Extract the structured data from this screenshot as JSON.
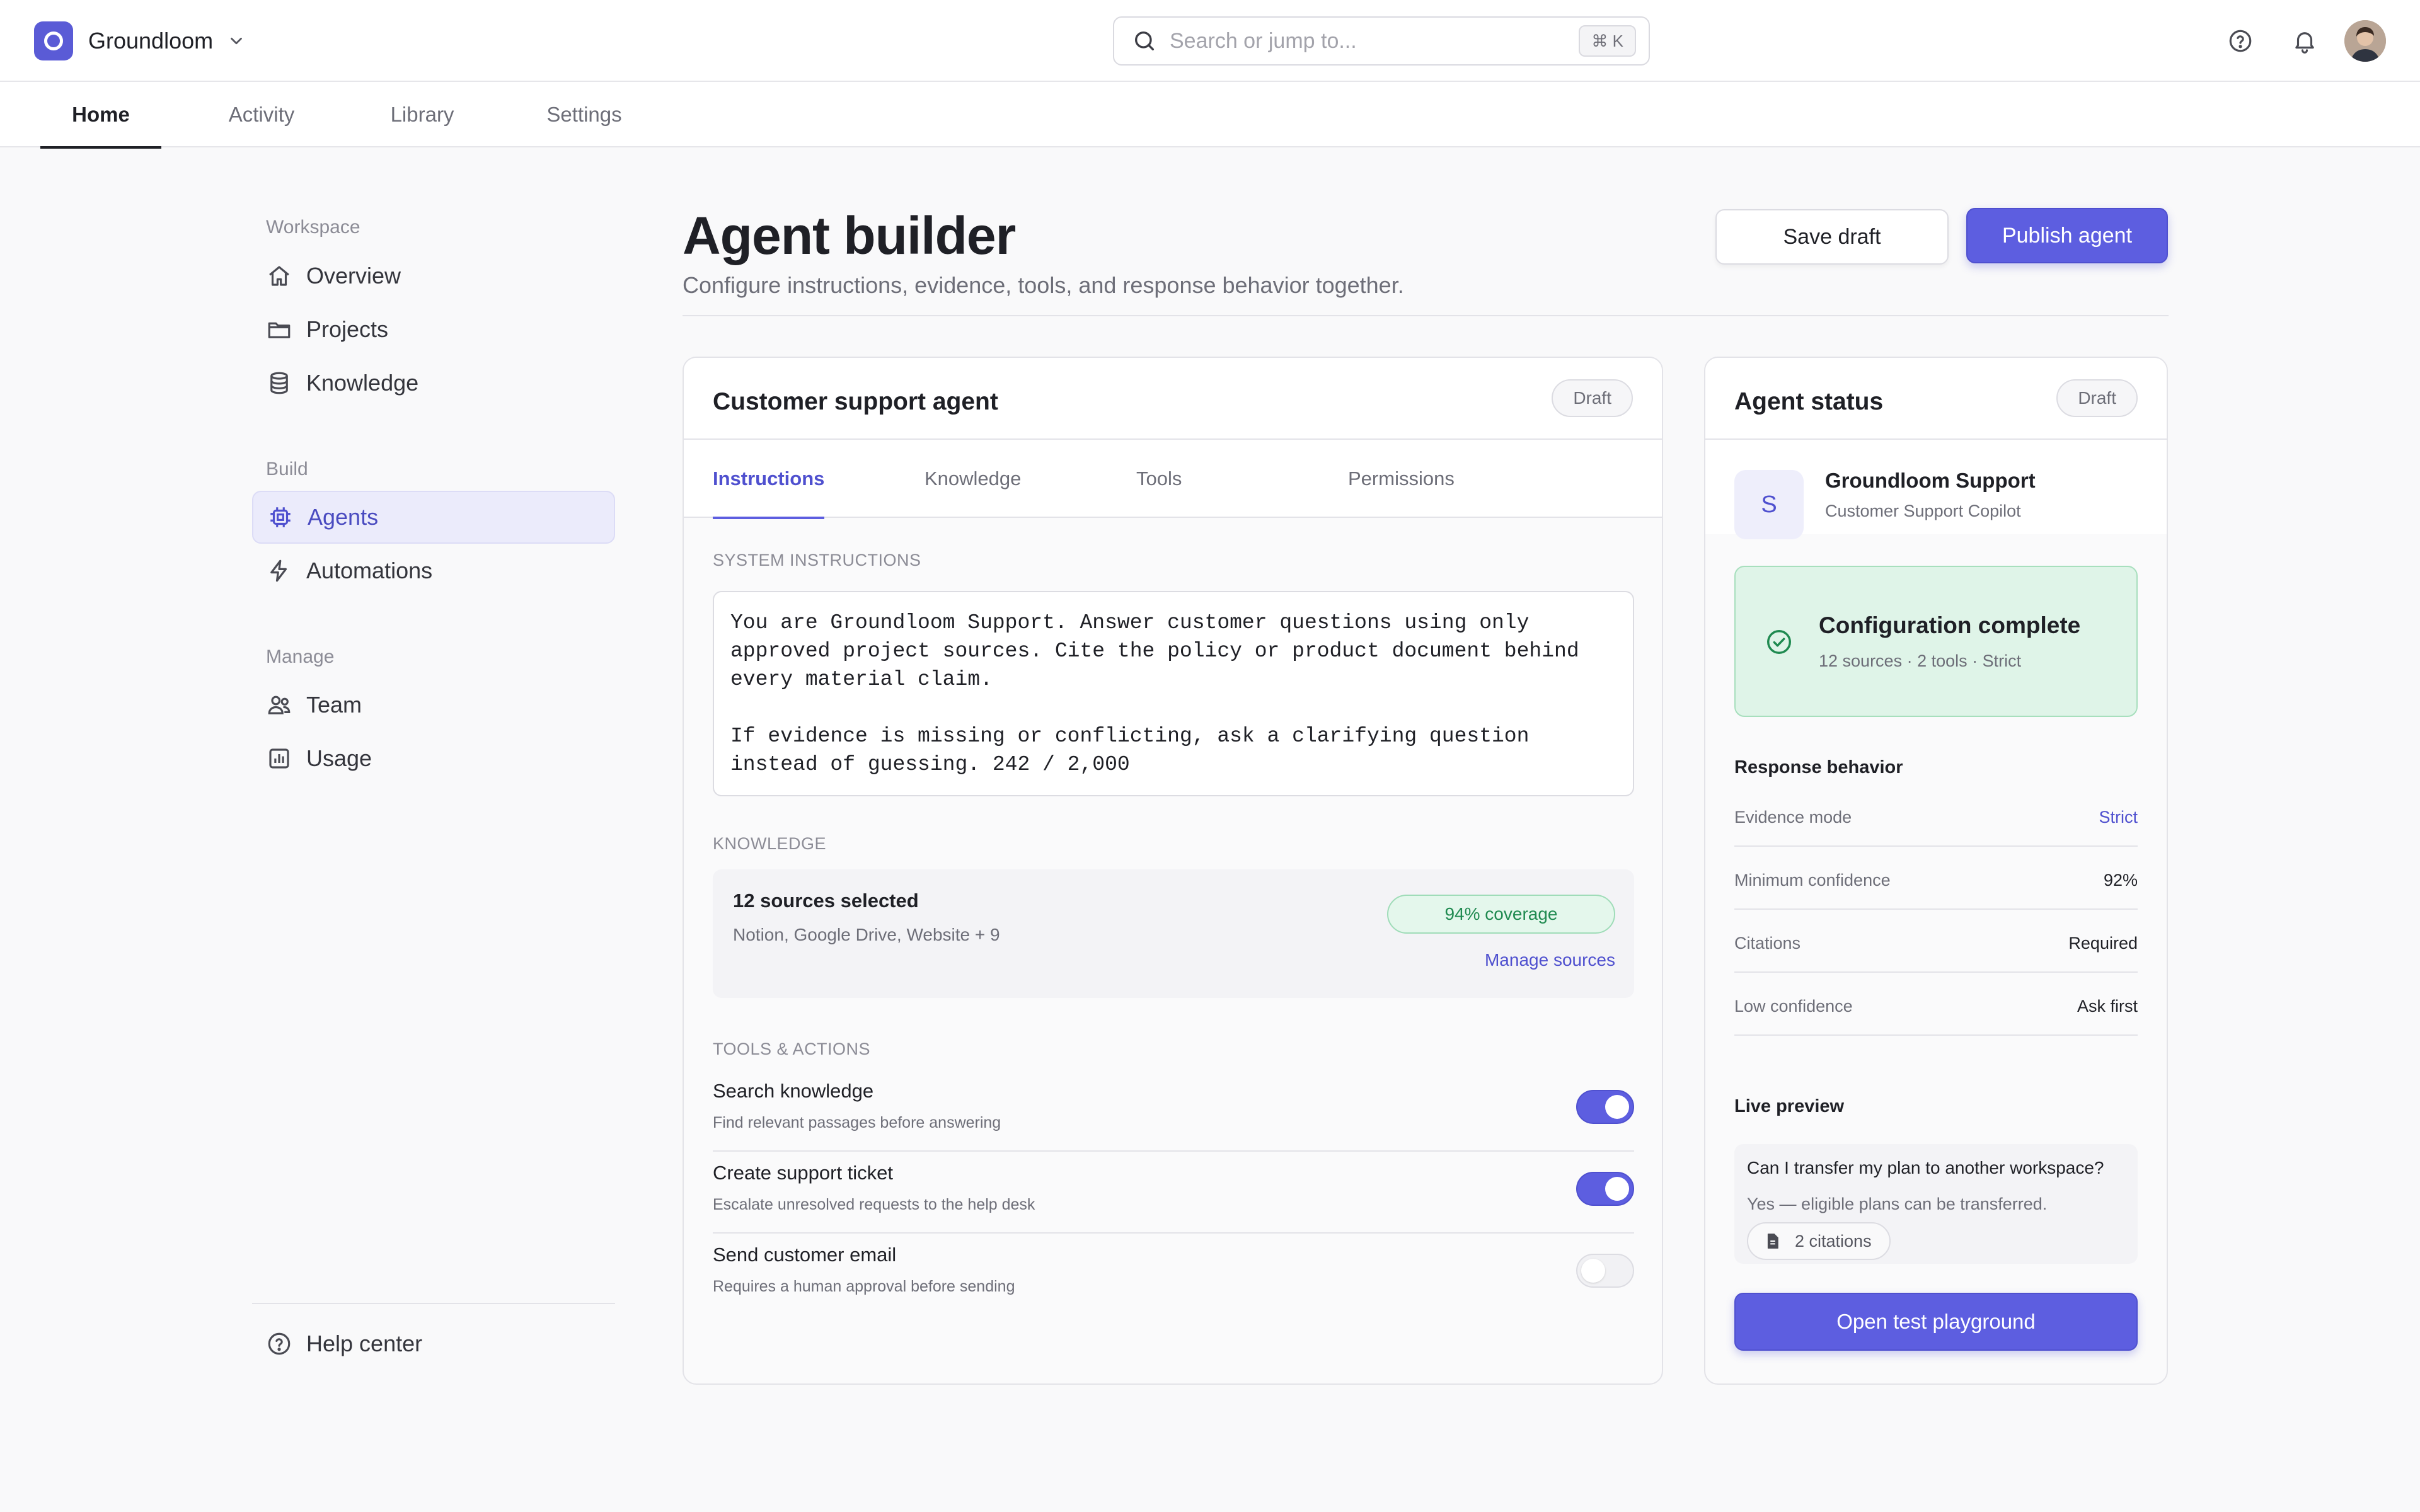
{
  "app": {
    "name": "Groundloom",
    "search_placeholder": "Search or jump to...",
    "search_shortcut": "⌘ K",
    "icons": [
      "help-icon",
      "bell-icon",
      "avatar"
    ]
  },
  "nav": {
    "tabs": [
      {
        "label": "Home",
        "active": true
      },
      {
        "label": "Activity",
        "active": false
      },
      {
        "label": "Library",
        "active": false
      },
      {
        "label": "Settings",
        "active": false
      }
    ]
  },
  "sidebar": {
    "sections": [
      {
        "title": "Workspace",
        "items": [
          {
            "label": "Overview",
            "icon": "home-icon"
          },
          {
            "label": "Projects",
            "icon": "folder-icon"
          },
          {
            "label": "Knowledge",
            "icon": "database-icon"
          }
        ]
      },
      {
        "title": "Build",
        "items": [
          {
            "label": "Agents",
            "icon": "chip-icon",
            "active": true
          },
          {
            "label": "Automations",
            "icon": "bolt-icon"
          }
        ]
      },
      {
        "title": "Manage",
        "items": [
          {
            "label": "Team",
            "icon": "users-icon"
          },
          {
            "label": "Usage",
            "icon": "bar-chart-icon"
          }
        ]
      }
    ],
    "footer": {
      "label": "Help center",
      "icon": "help-icon"
    }
  },
  "page": {
    "title": "Agent builder",
    "subtitle": "Configure instructions, evidence, tools, and response behavior together.",
    "save_label": "Save draft",
    "publish_label": "Publish agent"
  },
  "agent_card": {
    "title": "Customer support agent",
    "badge": "Draft",
    "tabs": [
      {
        "label": "Instructions",
        "active": true
      },
      {
        "label": "Knowledge",
        "active": false
      },
      {
        "label": "Tools",
        "active": false
      },
      {
        "label": "Permissions",
        "active": false
      }
    ],
    "instructions_label": "SYSTEM INSTRUCTIONS",
    "instructions_text": "You are Groundloom Support. Answer customer questions using only approved project sources. Cite the policy or product document behind every material claim.\n\nIf evidence is missing or conflicting, ask a clarifying question instead of guessing. 242 / 2,000",
    "knowledge_label": "KNOWLEDGE",
    "knowledge": {
      "title": "12 sources selected",
      "sources": "Notion, Google Drive, Website + 9",
      "coverage": "94% coverage",
      "manage_label": "Manage sources"
    },
    "tools_label": "TOOLS & ACTIONS",
    "tools": [
      {
        "name": "Search knowledge",
        "desc": "Find relevant passages before answering",
        "enabled": true
      },
      {
        "name": "Create support ticket",
        "desc": "Escalate unresolved requests to the help desk",
        "enabled": true
      },
      {
        "name": "Send customer email",
        "desc": "Requires a human approval before sending",
        "enabled": false
      }
    ]
  },
  "status_card": {
    "title": "Agent status",
    "badge": "Draft",
    "profile": {
      "initial": "S",
      "name": "Groundloom Support",
      "role": "Customer Support Copilot"
    },
    "config": {
      "title": "Configuration complete",
      "detail": "12 sources · 2 tools · Strict"
    },
    "response_title": "Response behavior",
    "response": [
      {
        "key": "Evidence mode",
        "value": "Strict",
        "accent": true
      },
      {
        "key": "Minimum confidence",
        "value": "92%"
      },
      {
        "key": "Citations",
        "value": "Required"
      },
      {
        "key": "Low confidence",
        "value": "Ask first"
      }
    ],
    "preview_title": "Live preview",
    "preview": {
      "question": "Can I transfer my plan to another workspace?",
      "answer": "Yes — eligible plans can be transferred.",
      "citations": "2 citations"
    },
    "playground_label": "Open test playground"
  },
  "colors": {
    "accent": "#5d5ee0",
    "success_bg": "#dff4e8",
    "success_text": "#1f8a50"
  }
}
